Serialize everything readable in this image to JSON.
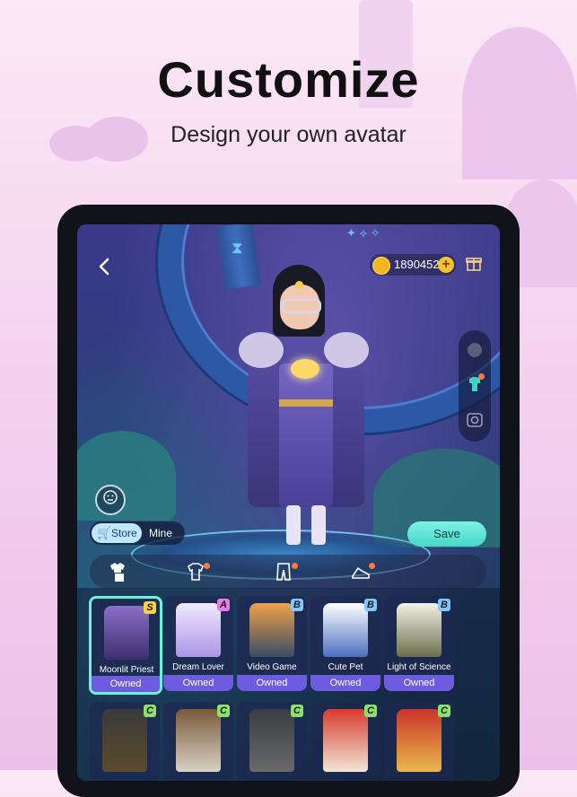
{
  "banner": {
    "title": "Customize",
    "subtitle": "Design your own avatar"
  },
  "topbar": {
    "coins": "1890452"
  },
  "toggle": {
    "store_label": "Store",
    "mine_label": "Mine"
  },
  "save_label": "Save",
  "tabs": [
    {
      "name": "outfit-set",
      "active": true
    },
    {
      "name": "top",
      "has_dot": true
    },
    {
      "name": "bottoms",
      "has_dot": true
    },
    {
      "name": "shoes",
      "has_dot": true
    }
  ],
  "items": [
    {
      "name": "Moonlit Priest",
      "grade": "S",
      "status": "Owned",
      "selected": true
    },
    {
      "name": "Dream Lover",
      "grade": "A",
      "status": "Owned"
    },
    {
      "name": "Video Game",
      "grade": "B",
      "status": "Owned"
    },
    {
      "name": "Cute Pet",
      "grade": "B",
      "status": "Owned"
    },
    {
      "name": "Light of Science",
      "grade": "B",
      "status": "Owned"
    }
  ],
  "items_row2": [
    {
      "grade": "C"
    },
    {
      "grade": "C"
    },
    {
      "grade": "C"
    },
    {
      "grade": "C"
    },
    {
      "grade": "C"
    }
  ],
  "colors": {
    "accent_teal": "#6ff0dc",
    "owned_purple": "#6f5be0",
    "grade_S": "#f7d14a",
    "grade_A": "#e77ce6",
    "grade_B": "#7fc8ff",
    "grade_C": "#8de36a"
  }
}
